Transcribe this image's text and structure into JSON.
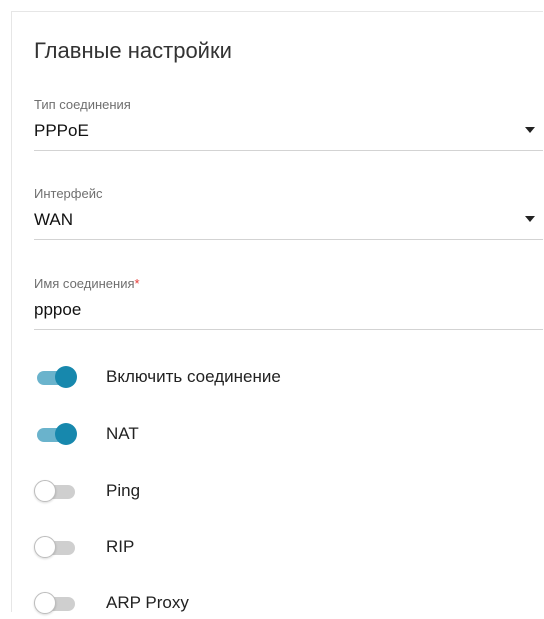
{
  "section": {
    "title": "Главные настройки"
  },
  "fields": {
    "connection_type": {
      "label": "Тип соединения",
      "value": "PPPoE"
    },
    "interface": {
      "label": "Интерфейс",
      "value": "WAN"
    },
    "connection_name": {
      "label": "Имя соединения",
      "required_mark": "*",
      "value": "pppoe"
    }
  },
  "toggles": [
    {
      "label": "Включить соединение",
      "state": "on"
    },
    {
      "label": "NAT",
      "state": "on"
    },
    {
      "label": "Ping",
      "state": "off"
    },
    {
      "label": "RIP",
      "state": "off"
    },
    {
      "label": "ARP Proxy",
      "state": "off"
    }
  ],
  "colors": {
    "accent": "#1788ad",
    "accent_track": "#6ab3cc",
    "required": "#e53935"
  }
}
